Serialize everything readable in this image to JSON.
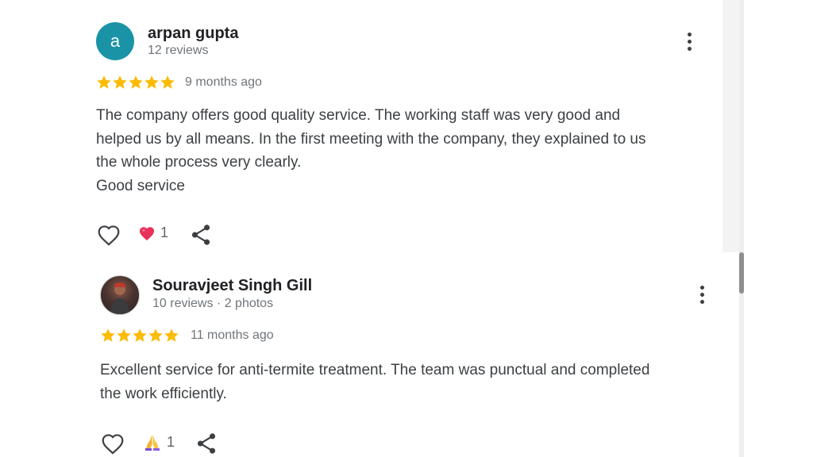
{
  "reviews": [
    {
      "avatar_letter": "a",
      "avatar_color": "#1a93a6",
      "author": "arpan gupta",
      "meta": "12 reviews",
      "rating": 5,
      "age": "9 months ago",
      "lines": [
        "The company offers good quality service. The working staff was very good and",
        "helped us by all means. In the first meeting with the company, they explained to us",
        "the whole process very clearly.",
        "Good service"
      ],
      "reaction_icon": "heart-emoji-icon",
      "reaction_count": "1"
    },
    {
      "avatar_letter": "",
      "author": "Souravjeet Singh Gill",
      "meta": "10 reviews · 2 photos",
      "rating": 5,
      "age": "11 months ago",
      "lines": [
        "Excellent service for anti-termite treatment. The team was punctual and completed",
        "the work efficiently."
      ],
      "reaction_icon": "folded-hands-emoji-icon",
      "reaction_count": "1"
    }
  ],
  "colors": {
    "star": "#fbbc04",
    "heart_emoji": "#e8325a",
    "text": "#3c4043",
    "secondary": "#70757a"
  }
}
